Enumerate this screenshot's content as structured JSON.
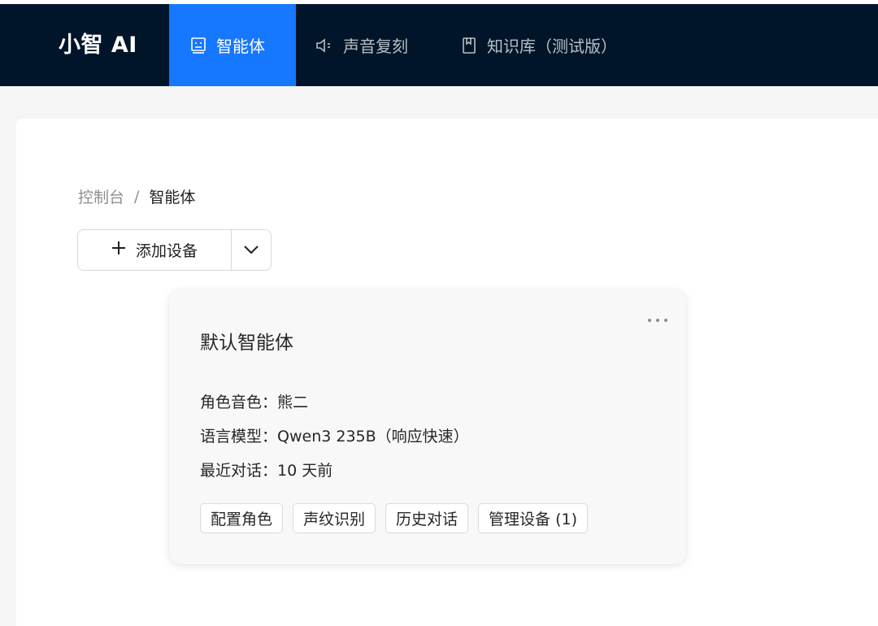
{
  "app": {
    "title": "小智 AI"
  },
  "nav": {
    "items": [
      {
        "label": "智能体",
        "icon": "robot-icon",
        "active": true
      },
      {
        "label": "声音复刻",
        "icon": "sound-icon",
        "active": false
      },
      {
        "label": "知识库（测试版）",
        "icon": "book-icon",
        "active": false
      }
    ]
  },
  "breadcrumb": {
    "root": "控制台",
    "separator": "/",
    "current": "智能体"
  },
  "toolbar": {
    "add_label": "添加设备",
    "add_icon": "plus-icon",
    "dropdown_icon": "chevron-down-icon"
  },
  "card": {
    "title": "默认智能体",
    "more_icon": "more-horizontal-icon",
    "fields": [
      {
        "label": "角色音色：",
        "value": "熊二"
      },
      {
        "label": "语言模型：",
        "value": "Qwen3 235B（响应快速）"
      },
      {
        "label": "最近对话：",
        "value": "10 天前"
      }
    ],
    "actions": [
      "配置角色",
      "声纹识别",
      "历史对话",
      "管理设备 (1)"
    ]
  },
  "colors": {
    "nav_background": "#001529",
    "nav_active": "#1677ff",
    "content_background": "#f5f5f5",
    "card_background": "#f8f8f8",
    "border": "#d9d9d9"
  }
}
